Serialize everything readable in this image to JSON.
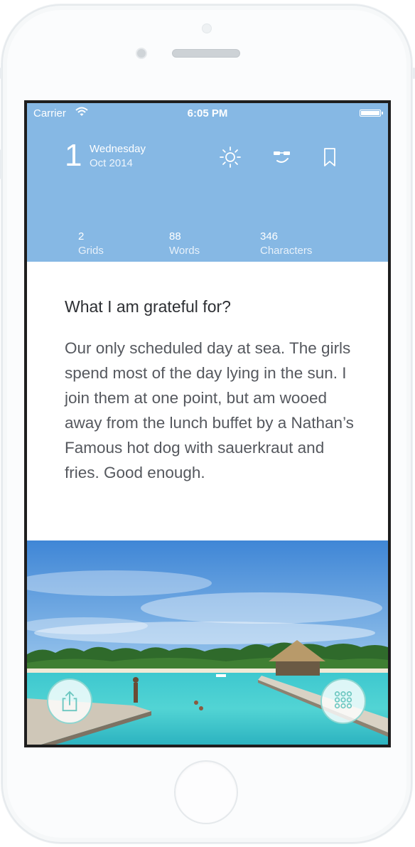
{
  "status": {
    "carrier": "Carrier",
    "time": "6:05 PM"
  },
  "date": {
    "day": "1",
    "weekday": "Wednesday",
    "month_year": "Oct 2014"
  },
  "header_icons": [
    "sun-icon",
    "mood-face-icon",
    "bookmark-icon"
  ],
  "stats": [
    {
      "value": "2",
      "label": "Grids"
    },
    {
      "value": "88",
      "label": "Words"
    },
    {
      "value": "346",
      "label": "Characters"
    }
  ],
  "entry": {
    "question": "What I am grateful for?",
    "text": "Our only scheduled day at sea. The girls spend most of the day lying in the sun. I join them at one point, but am wooed away from the lunch buffet by a Nathan’s Famous hot dog with sauerkraut and fries. Good enough."
  },
  "buttons": {
    "share": "share-icon",
    "grid": "grid-icon"
  },
  "colors": {
    "header": "#86b8e4",
    "accent": "#8fd6d0",
    "text": "#55585e"
  }
}
